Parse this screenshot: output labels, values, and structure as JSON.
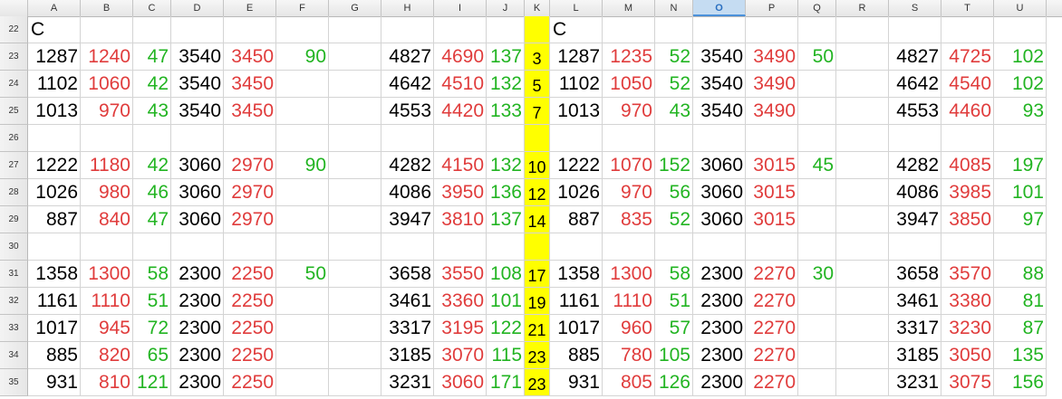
{
  "columns": [
    "A",
    "B",
    "C",
    "D",
    "E",
    "F",
    "G",
    "H",
    "I",
    "J",
    "K",
    "L",
    "M",
    "N",
    "O",
    "P",
    "Q",
    "R",
    "S",
    "T",
    "U"
  ],
  "selected_column": "O",
  "rows": [
    {
      "num": "22",
      "cells": [
        "C",
        "",
        "",
        "",
        "",
        "",
        "",
        "",
        "",
        "",
        "",
        "C",
        "",
        "",
        "",
        "",
        "",
        "",
        "",
        "",
        ""
      ]
    },
    {
      "num": "23",
      "cells": [
        "1287",
        "1240",
        "47",
        "3540",
        "3450",
        "90",
        "",
        "4827",
        "4690",
        "137",
        "3",
        "1287",
        "1235",
        "52",
        "3540",
        "3490",
        "50",
        "",
        "4827",
        "4725",
        "102"
      ]
    },
    {
      "num": "24",
      "cells": [
        "1102",
        "1060",
        "42",
        "3540",
        "3450",
        "",
        "",
        "4642",
        "4510",
        "132",
        "5",
        "1102",
        "1050",
        "52",
        "3540",
        "3490",
        "",
        "",
        "4642",
        "4540",
        "102"
      ]
    },
    {
      "num": "25",
      "cells": [
        "1013",
        "970",
        "43",
        "3540",
        "3450",
        "",
        "",
        "4553",
        "4420",
        "133",
        "7",
        "1013",
        "970",
        "43",
        "3540",
        "3490",
        "",
        "",
        "4553",
        "4460",
        "93"
      ]
    },
    {
      "num": "26",
      "cells": [
        "",
        "",
        "",
        "",
        "",
        "",
        "",
        "",
        "",
        "",
        "",
        "",
        "",
        "",
        "",
        "",
        "",
        "",
        "",
        "",
        ""
      ]
    },
    {
      "num": "27",
      "cells": [
        "1222",
        "1180",
        "42",
        "3060",
        "2970",
        "90",
        "",
        "4282",
        "4150",
        "132",
        "10",
        "1222",
        "1070",
        "152",
        "3060",
        "3015",
        "45",
        "",
        "4282",
        "4085",
        "197"
      ]
    },
    {
      "num": "28",
      "cells": [
        "1026",
        "980",
        "46",
        "3060",
        "2970",
        "",
        "",
        "4086",
        "3950",
        "136",
        "12",
        "1026",
        "970",
        "56",
        "3060",
        "3015",
        "",
        "",
        "4086",
        "3985",
        "101"
      ]
    },
    {
      "num": "29",
      "cells": [
        "887",
        "840",
        "47",
        "3060",
        "2970",
        "",
        "",
        "3947",
        "3810",
        "137",
        "14",
        "887",
        "835",
        "52",
        "3060",
        "3015",
        "",
        "",
        "3947",
        "3850",
        "97"
      ]
    },
    {
      "num": "30",
      "cells": [
        "",
        "",
        "",
        "",
        "",
        "",
        "",
        "",
        "",
        "",
        "",
        "",
        "",
        "",
        "",
        "",
        "",
        "",
        "",
        "",
        ""
      ]
    },
    {
      "num": "31",
      "cells": [
        "1358",
        "1300",
        "58",
        "2300",
        "2250",
        "50",
        "",
        "3658",
        "3550",
        "108",
        "17",
        "1358",
        "1300",
        "58",
        "2300",
        "2270",
        "30",
        "",
        "3658",
        "3570",
        "88"
      ]
    },
    {
      "num": "32",
      "cells": [
        "1161",
        "1110",
        "51",
        "2300",
        "2250",
        "",
        "",
        "3461",
        "3360",
        "101",
        "19",
        "1161",
        "1110",
        "51",
        "2300",
        "2270",
        "",
        "",
        "3461",
        "3380",
        "81"
      ]
    },
    {
      "num": "33",
      "cells": [
        "1017",
        "945",
        "72",
        "2300",
        "2250",
        "",
        "",
        "3317",
        "3195",
        "122",
        "21",
        "1017",
        "960",
        "57",
        "2300",
        "2270",
        "",
        "",
        "3317",
        "3230",
        "87"
      ]
    },
    {
      "num": "34",
      "cells": [
        "885",
        "820",
        "65",
        "2300",
        "2250",
        "",
        "",
        "3185",
        "3070",
        "115",
        "23",
        "885",
        "780",
        "105",
        "2300",
        "2270",
        "",
        "",
        "3185",
        "3050",
        "135"
      ]
    },
    {
      "num": "35",
      "cells": [
        "931",
        "810",
        "121",
        "2300",
        "2250",
        "",
        "",
        "3231",
        "3060",
        "171",
        "23",
        "931",
        "805",
        "126",
        "2300",
        "2270",
        "",
        "",
        "3231",
        "3075",
        "156"
      ]
    }
  ],
  "colors": {
    "black": "#000000",
    "red": "#e03c3c",
    "green": "#22b422",
    "highlight": "#ffff00",
    "selected_header": "#c5dcf2"
  }
}
